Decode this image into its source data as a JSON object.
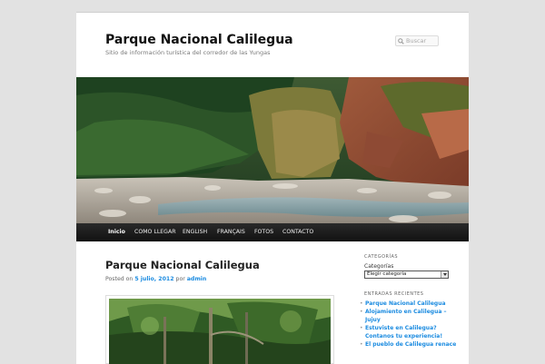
{
  "site": {
    "title": "Parque Nacional Calilegua",
    "description": "Sitio de información turística del corredor de las Yungas"
  },
  "search": {
    "placeholder": "Buscar"
  },
  "nav": {
    "items": [
      {
        "label": "Inicio",
        "active": true
      },
      {
        "label": "COMO LLEGAR"
      },
      {
        "label": "ENGLISH"
      },
      {
        "label": "FRANÇAIS"
      },
      {
        "label": "FOTOS"
      },
      {
        "label": "CONTACTO"
      }
    ]
  },
  "post": {
    "title": "Parque Nacional Calilegua",
    "posted_on": "Posted on",
    "date": "5 julio, 2012",
    "by": "por",
    "author": "admin"
  },
  "sidebar": {
    "categories_title": "CATEGORÍAS",
    "categories_label": "Categorías",
    "categories_select": "Elegir categoría",
    "recent_title": "ENTRADAS RECIENTES",
    "recent_items": [
      "Parque Nacional Calilegua",
      "Alojamiento en Calilegua – Jujuy",
      "Estuviste en Calilegua? Contanos tu experiencia!",
      "El pueblo de Calilegua renace"
    ]
  },
  "colors": {
    "link": "#1b8be0",
    "nav_bg": "#1a1a1a",
    "page_bg": "#e2e2e2"
  }
}
